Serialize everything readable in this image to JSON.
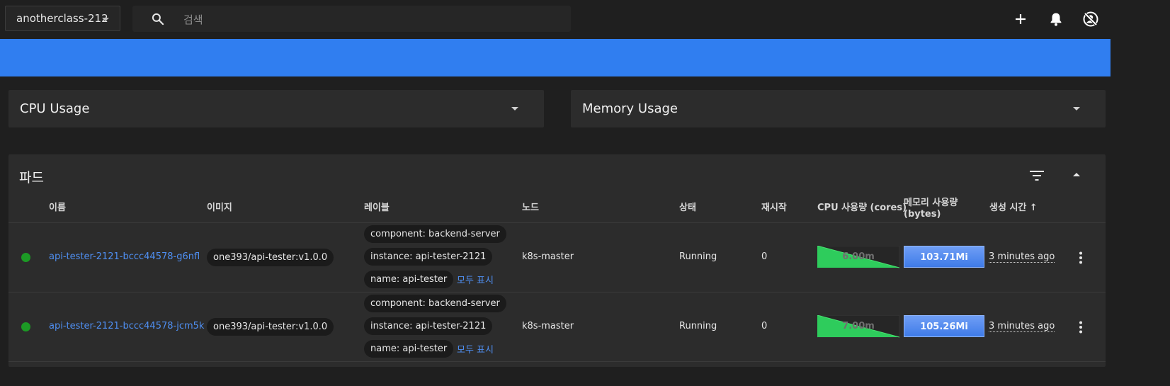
{
  "header": {
    "namespace": "anotherclass-212",
    "search_placeholder": "검색",
    "icons": [
      "search-icon",
      "plus-icon",
      "bell-icon",
      "avatar-icon"
    ]
  },
  "banner": {
    "color": "#307ef0"
  },
  "panels": {
    "cpu": {
      "title": "CPU Usage"
    },
    "memory": {
      "title": "Memory Usage"
    }
  },
  "pods": {
    "title": "파드",
    "columns": {
      "name": "이름",
      "image": "이미지",
      "labels": "레이블",
      "node": "노드",
      "status": "상태",
      "restarts": "재시작",
      "cpu": "CPU 사용량 (cores)",
      "memory_line1": "메모리 사용량",
      "memory_line2": "(bytes)",
      "created": "생성 시간 ↑"
    },
    "rows": [
      {
        "name": "api-tester-2121-bccc44578-g6nfl",
        "image": "one393/api-tester:v1.0.0",
        "labels": [
          "component: backend-server",
          "instance: api-tester-2121",
          "name: api-tester"
        ],
        "show_all": "모두 표시",
        "node": "k8s-master",
        "status": "Running",
        "restarts": "0",
        "cpu": "6.00m",
        "memory": "103.71Mi",
        "created": "3 minutes ago"
      },
      {
        "name": "api-tester-2121-bccc44578-jcm5k",
        "image": "one393/api-tester:v1.0.0",
        "labels": [
          "component: backend-server",
          "instance: api-tester-2121",
          "name: api-tester"
        ],
        "show_all": "모두 표시",
        "node": "k8s-master",
        "status": "Running",
        "restarts": "0",
        "cpu": "7.00m",
        "memory": "105.26Mi",
        "created": "3 minutes ago"
      }
    ]
  },
  "colors": {
    "status_running": "#1c9a25",
    "link": "#4f8ff2",
    "cpu_spark": "#2ecc5c",
    "memory_bar": "#3f7be8"
  }
}
